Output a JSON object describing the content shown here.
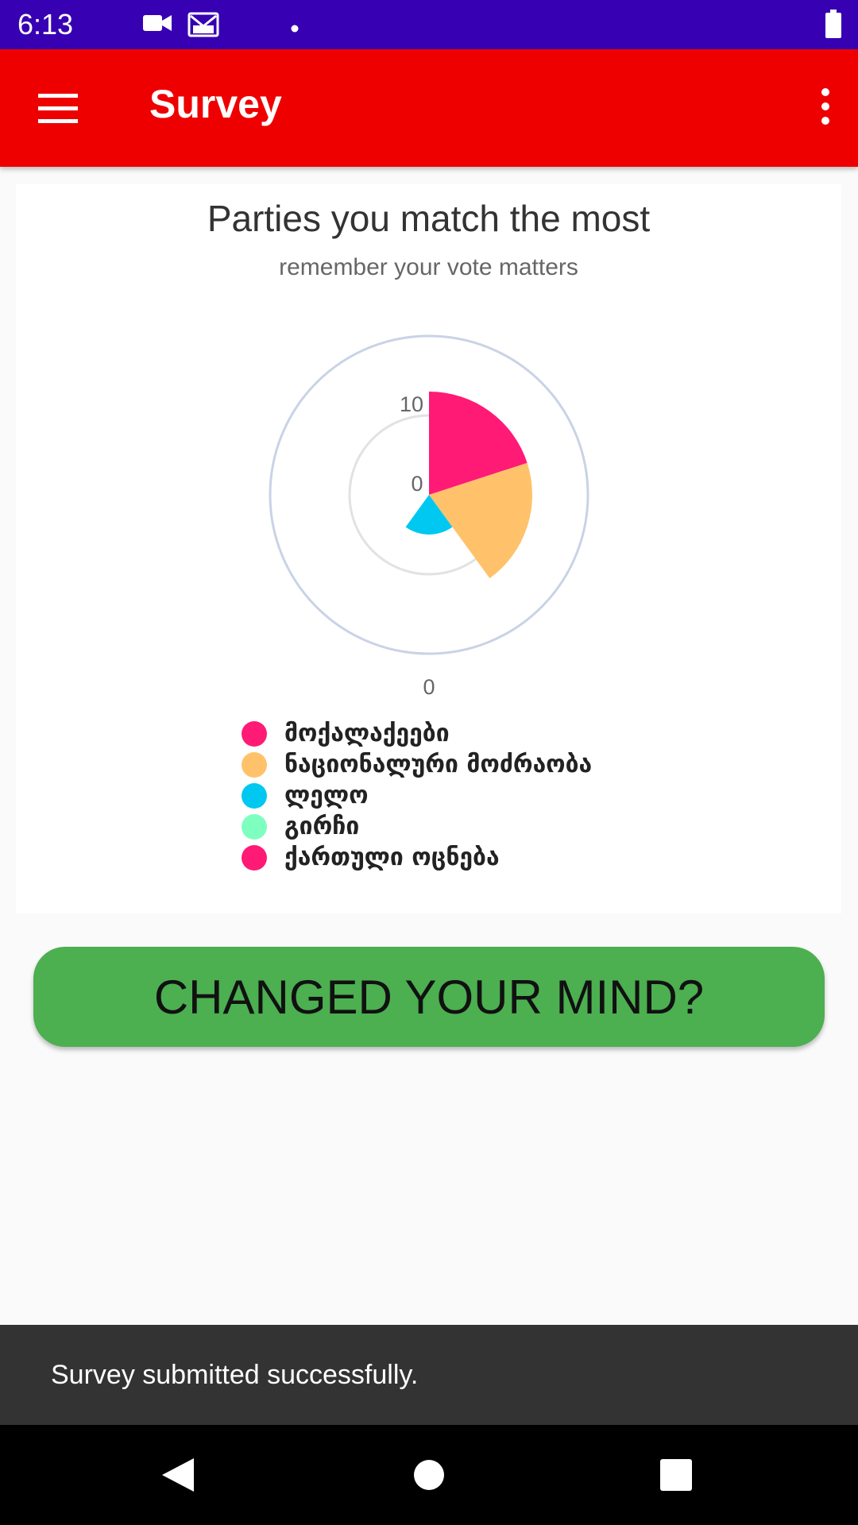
{
  "status_bar": {
    "time": "6:13",
    "icons": [
      "video-camera-icon",
      "gmail-icon",
      "notification-dot-icon",
      "battery-icon"
    ]
  },
  "app_bar": {
    "title": "Survey",
    "menu_icon": "hamburger-menu-icon",
    "overflow_icon": "overflow-menu-icon",
    "color": "#ee0000"
  },
  "chart_data": {
    "type": "polar-area",
    "title": "Parties you match the most",
    "subtitle": "remember your vote matters",
    "radial_ticks": [
      "10",
      "0"
    ],
    "bottom_label": "0",
    "series": [
      {
        "name": "მოქალაქეები",
        "value": 13,
        "color": "#ff1a75"
      },
      {
        "name": "ნაციონალური მოძრაობა",
        "value": 13,
        "color": "#ffc26b"
      },
      {
        "name": "ლელო",
        "value": 5,
        "color": "#00c8f0"
      },
      {
        "name": "გირჩი",
        "value": 0,
        "color": "#7fffbf"
      },
      {
        "name": "ქართული ოცნება",
        "value": 0,
        "color": "#ff1a75"
      }
    ],
    "legend_position": "bottom"
  },
  "actions": {
    "change_mind_label": "CHANGED YOUR MIND?",
    "button_color": "#4caf50"
  },
  "snackbar": {
    "message": "Survey submitted successfully."
  },
  "nav_bar": {
    "icons": [
      "back-icon",
      "home-icon",
      "recents-icon"
    ]
  }
}
